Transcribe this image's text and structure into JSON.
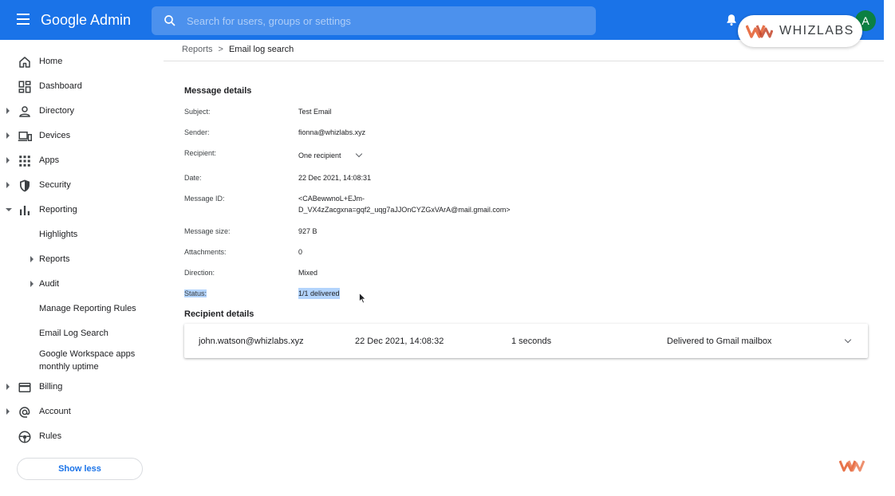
{
  "app": {
    "title": "Google Admin"
  },
  "search": {
    "placeholder": "Search for users, groups or settings"
  },
  "account": {
    "avatar_letter": "A"
  },
  "watermark": {
    "brand": "WHIZLABS"
  },
  "sidebar": {
    "items": [
      {
        "label": "Home",
        "icon": "home-icon"
      },
      {
        "label": "Dashboard",
        "icon": "dashboard-icon"
      },
      {
        "label": "Directory",
        "icon": "person-icon"
      },
      {
        "label": "Devices",
        "icon": "devices-icon"
      },
      {
        "label": "Apps",
        "icon": "apps-grid-icon"
      },
      {
        "label": "Security",
        "icon": "shield-icon"
      },
      {
        "label": "Reporting",
        "icon": "bar-chart-icon"
      },
      {
        "label": "Highlights"
      },
      {
        "label": "Reports"
      },
      {
        "label": "Audit"
      },
      {
        "label": "Manage Reporting Rules"
      },
      {
        "label": "Email Log Search"
      },
      {
        "label": "Google Workspace apps monthly uptime"
      },
      {
        "label": "Billing",
        "icon": "credit-card-icon"
      },
      {
        "label": "Account",
        "icon": "at-sign-icon"
      },
      {
        "label": "Rules",
        "icon": "rules-icon"
      }
    ],
    "show_less": "Show less"
  },
  "breadcrumb": {
    "parent": "Reports",
    "separator": ">",
    "current": "Email log search"
  },
  "message_details": {
    "title": "Message details",
    "subject_label": "Subject:",
    "subject": "Test Email",
    "sender_label": "Sender:",
    "sender": "fionna@whizlabs.xyz",
    "recipient_label": "Recipient:",
    "recipient": "One recipient",
    "date_label": "Date:",
    "date": "22 Dec 2021, 14:08:31",
    "message_id_label": "Message ID:",
    "message_id_line1": "<CABewwnoL+EJm-",
    "message_id_line2": "D_VX4zZacgxna=gqf2_uqg7aJJOnCYZGxVArA@mail.gmail.com>",
    "size_label": "Message size:",
    "size": "927 B",
    "attachments_label": "Attachments:",
    "attachments": "0",
    "direction_label": "Direction:",
    "direction": "Mixed",
    "status_label": "Status:",
    "status": "1/1 delivered"
  },
  "recipient_details": {
    "title": "Recipient details",
    "rows": [
      {
        "email": "john.watson@whizlabs.xyz",
        "timestamp": "22 Dec 2021, 14:08:32",
        "duration": "1 seconds",
        "status": "Delivered to Gmail mailbox"
      }
    ]
  },
  "colors": {
    "topbar": "#1a73e8",
    "link": "#1a73e8",
    "avatar": "#0b8043",
    "whizlabs_orange": "#e8734a",
    "selection": "#b3d4fc"
  }
}
